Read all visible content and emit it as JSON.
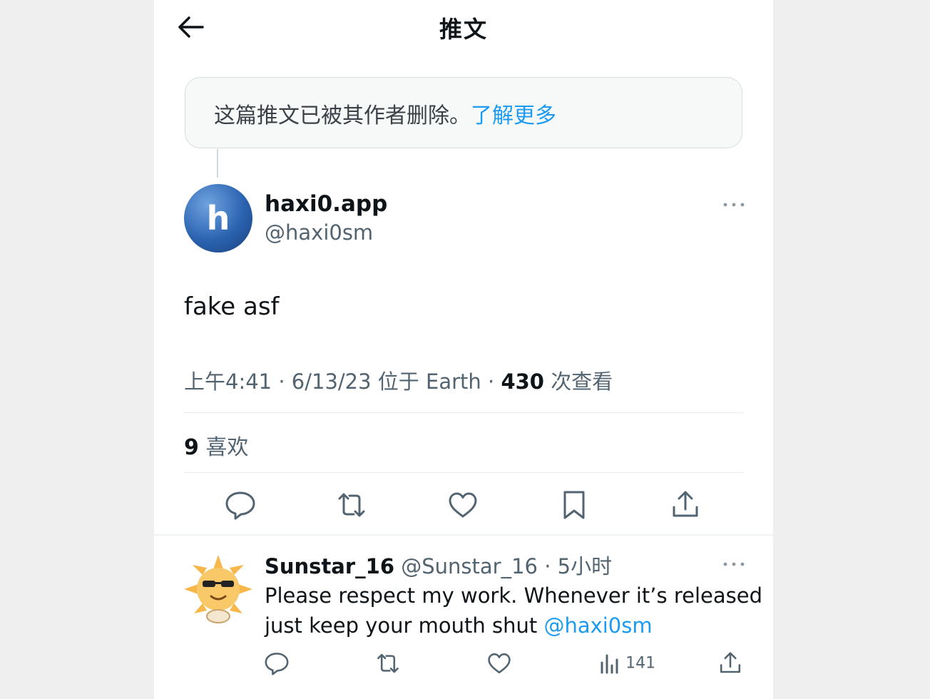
{
  "header": {
    "title": "推文"
  },
  "deleted_notice": {
    "text": "这篇推文已被其作者删除。",
    "link": "了解更多"
  },
  "tweet": {
    "avatar_letter": "h",
    "display_name": "haxi0.app",
    "handle": "@haxi0sm",
    "text": "fake asf",
    "meta_time": "上午4:41 · 6/13/23 位于 Earth · ",
    "views": "430",
    "views_label": " 次查看",
    "likes": "9",
    "likes_label": " 喜欢"
  },
  "reply": {
    "display_name": "Sunstar_16",
    "handle_time": " @Sunstar_16 · 5小时",
    "text": "Please respect my work. Whenever it’s released just keep your mouth shut ",
    "mention": "@haxi0sm",
    "views": "141"
  },
  "icons": [
    "back-arrow-icon",
    "more-icon",
    "reply-icon",
    "retweet-icon",
    "like-icon",
    "bookmark-icon",
    "share-icon",
    "views-icon"
  ],
  "colors": {
    "accent": "#1d9bf0",
    "secondary_text": "#536471",
    "primary_text": "#0f1419"
  }
}
